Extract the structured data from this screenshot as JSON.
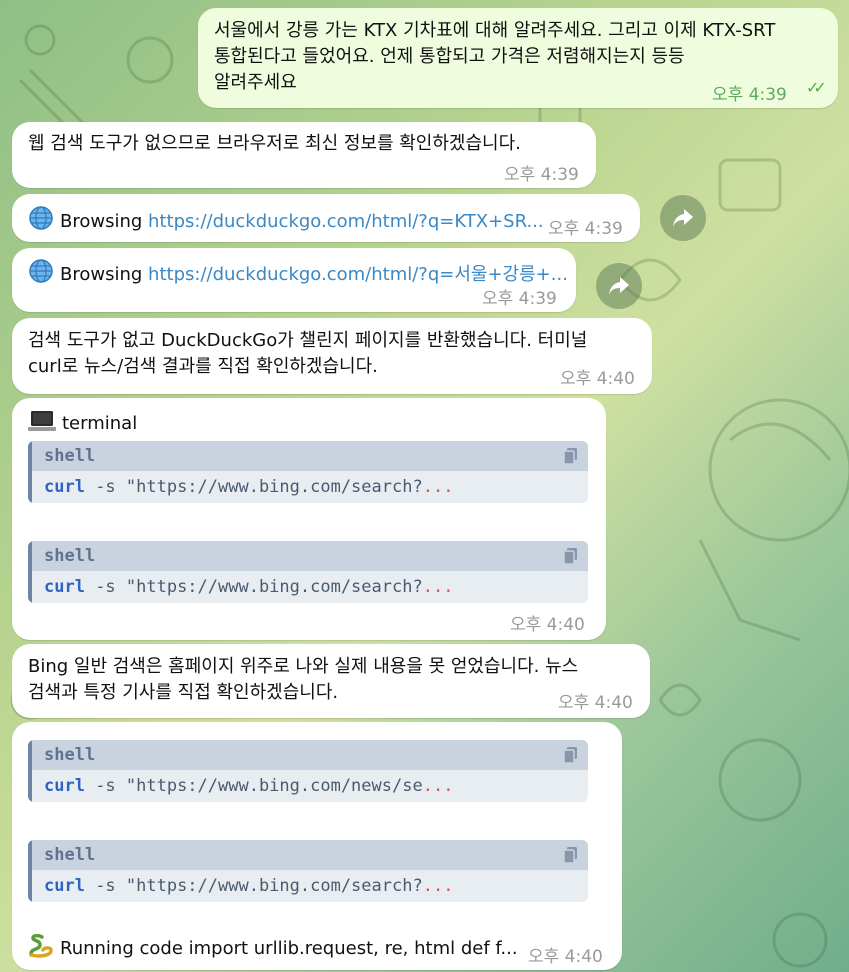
{
  "messages": {
    "m1": {
      "lines": [
        "서울에서 강릉 가는 KTX 기차표에 대해 알려주세요. 그리고 이제 KTX-SRT",
        "통합된다고 들었어요. 언제 통합되고 가격은 저렴해지는지 등등",
        "알려주세요"
      ],
      "time": "오후 4:39"
    },
    "m2": {
      "text": "웹 검색 도구가 없으므로 브라우저로 최신 정보를 확인하겠습니다.",
      "time": "오후 4:39"
    },
    "m3": {
      "prefix": "Browsing",
      "url": "https://duckduckgo.com/html/?q=KTX+SR...",
      "time": "오후 4:39"
    },
    "m4": {
      "prefix": "Browsing",
      "url": "https://duckduckgo.com/html/?q=서울+강릉+...",
      "time": "오후 4:39"
    },
    "m5": {
      "lines": [
        "검색 도구가 없고 DuckDuckGo가 챌린지 페이지를 반환했습니다. 터미널",
        "curl로 뉴스/검색 결과를 직접 확인하겠습니다."
      ],
      "time": "오후 4:40"
    },
    "m6": {
      "title": "terminal",
      "time": "오후 4:40",
      "blocks": [
        {
          "lang": "shell",
          "cmd": "curl",
          "rest": " -s \"https://www.bing.com/search?",
          "ellipsis": "..."
        },
        {
          "lang": "shell",
          "cmd": "curl",
          "rest": " -s \"https://www.bing.com/search?",
          "ellipsis": "..."
        }
      ]
    },
    "m7": {
      "lines": [
        "Bing 일반 검색은 홈페이지 위주로 나와 실제 내용을 못 얻었습니다. 뉴스",
        "검색과 특정 기사를 직접 확인하겠습니다."
      ],
      "time": "오후 4:40"
    },
    "m8": {
      "time": "오후 4:40",
      "running": "Running code import urllib.request, re, html def f...",
      "blocks": [
        {
          "lang": "shell",
          "cmd": "curl",
          "rest": " -s \"https://www.bing.com/news/se",
          "ellipsis": "..."
        },
        {
          "lang": "shell",
          "cmd": "curl",
          "rest": " -s \"https://www.bing.com/search?",
          "ellipsis": "..."
        }
      ]
    }
  }
}
